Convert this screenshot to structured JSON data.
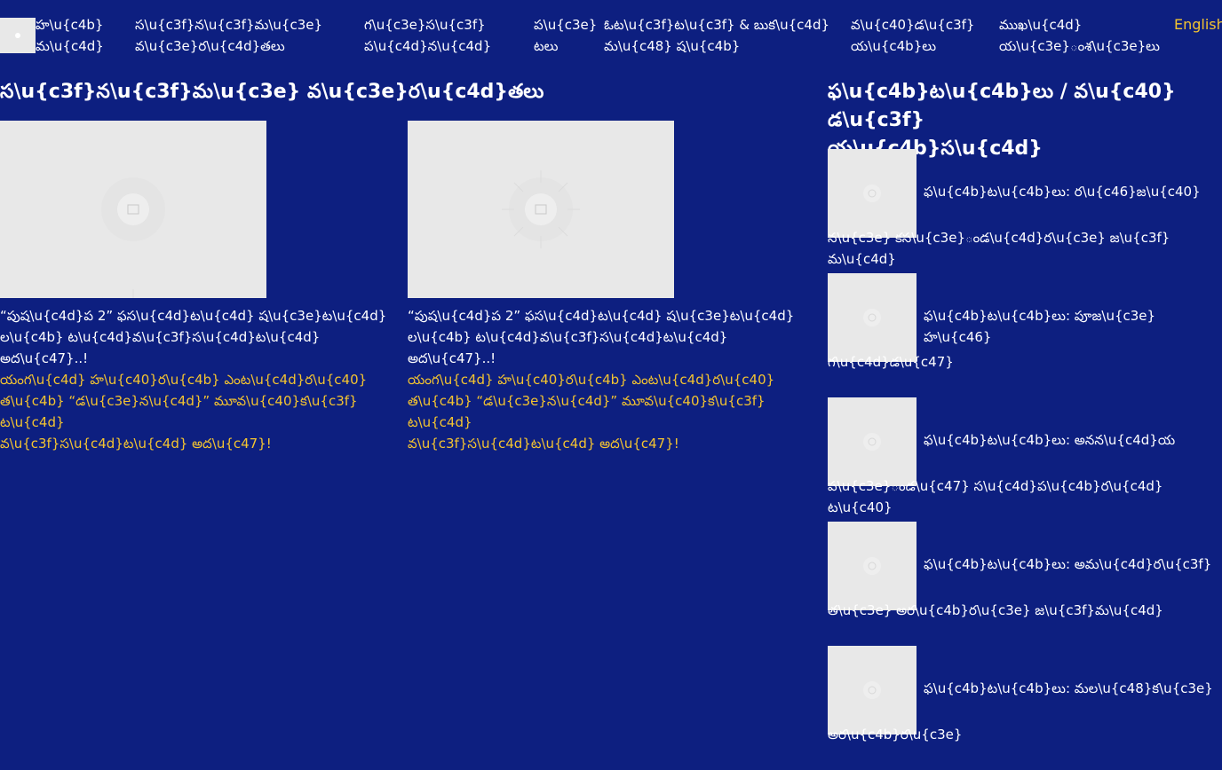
{
  "nav": {
    "items": [
      {
        "line1": "హ\\u{c4b}",
        "line2": "మ\\u{c4d}"
      },
      {
        "line1": "స\\u{c3f}న\\u{c3f}మ\\u{c3e}",
        "line2": "వ\\u{c3e}ర\\u{c4d}తలు"
      },
      {
        "line1": "గ\\u{c3e}స\\u{c3f}",
        "line2": "ప\\u{c4d}న\\u{c4d}"
      },
      {
        "line1": "ప\\u{c3e}",
        "line2": "టలు"
      },
      {
        "line1": "ఓట\\u{c3f}ట\\u{c3f} & బుక\\u{c4d}",
        "line2": "మ\\u{c48} ష\\u{c4b}"
      },
      {
        "line1": "వ\\u{c40}డ\\u{c3f}",
        "line2": "య\\u{c4b}లు"
      },
      {
        "line1": "ముఖ\\u{c4d}",
        "line2": "య\\u{c3e}ంశ\\u{c3e}లు"
      }
    ],
    "language": "English"
  },
  "section": {
    "title": "స\\u{c3f}న\\u{c3f}మ\\u{c3e} వ\\u{c3e}ర\\u{c4d}తలు"
  },
  "cards": [
    {
      "title_line1": "“పుష\\u{c4d}ప 2” ఫస\\u{c4d}ట\\u{c4d} ష\\u{c3e}ట\\u{c4d}",
      "title_line2": "ల\\u{c4b} ట\\u{c4d}వ\\u{c3f}స\\u{c4d}ట\\u{c4d} అద\\u{c47}..!",
      "desc_line1": "యంగ\\u{c4d} హ\\u{c40}ర\\u{c4b} ఎంట\\u{c4d}ర\\u{c40}",
      "desc_line2": "త\\u{c4b} “డ\\u{c3e}న\\u{c4d}” మూవ\\u{c40}క\\u{c3f} ట\\u{c4d}",
      "desc_line3": "వ\\u{c3f}స\\u{c4d}ట\\u{c4d} అద\\u{c47}!"
    },
    {
      "title_line1": "“పుష\\u{c4d}ప 2” ఫస\\u{c4d}ట\\u{c4d} ష\\u{c3e}ట\\u{c4d}",
      "title_line2": "ల\\u{c4b} ట\\u{c4d}వ\\u{c3f}స\\u{c4d}ట\\u{c4d} అద\\u{c47}..!",
      "desc_line1": "యంగ\\u{c4d} హ\\u{c40}ర\\u{c4b} ఎంట\\u{c4d}ర\\u{c40}",
      "desc_line2": "త\\u{c4b} “డ\\u{c3e}న\\u{c4d}” మూవ\\u{c40}క\\u{c3f} ట\\u{c4d}",
      "desc_line3": "వ\\u{c3f}స\\u{c4d}ట\\u{c4d} అద\\u{c47}!"
    }
  ],
  "sidebar": {
    "title_line1": "ఫ\\u{c4b}ట\\u{c4b}లు / వ\\u{c40}డ\\u{c3f}",
    "title_line2": "య\\u{c4b}స\\u{c4d}",
    "items": [
      {
        "line1": "ఫ\\u{c4b}ట\\u{c4b}లు: ర\\u{c46}జ\\u{c40}",
        "line2": "న\\u{c3e} కస\\u{c3e}ండ\\u{c4d}ర\\u{c3e} జ\\u{c3f}మ\\u{c4d}"
      },
      {
        "line1": "ఫ\\u{c4b}ట\\u{c4b}లు: పూజ\\u{c3e} హ\\u{c46}",
        "line2": "గ\\u{c4d}డ\\u{c47}"
      },
      {
        "line1": "ఫ\\u{c4b}ట\\u{c4b}లు: అనన\\u{c4d}య",
        "line2": "ప\\u{c3e}ండ\\u{c47} స\\u{c4d}ప\\u{c4b}ర\\u{c4d}ట\\u{c40}"
      },
      {
        "line1": "ఫ\\u{c4b}ట\\u{c4b}లు: అమ\\u{c4d}ర\\u{c3f}",
        "line2": "త\\u{c3e} అర\\u{c4b}ర\\u{c3e} జ\\u{c3f}మ\\u{c4d}"
      },
      {
        "line1": "ఫ\\u{c4b}ట\\u{c4b}లు: మల\\u{c48}క\\u{c3e}",
        "line2": "అర\\u{c4b}ర\\u{c3e}"
      }
    ]
  },
  "colors": {
    "background": "#0d1f80",
    "accent": "#f4c430",
    "text": "#ffffff",
    "placeholder": "#e8e8e8"
  },
  "icons": {
    "logo": "site-logo",
    "image_placeholder": "image-placeholder-icon"
  }
}
